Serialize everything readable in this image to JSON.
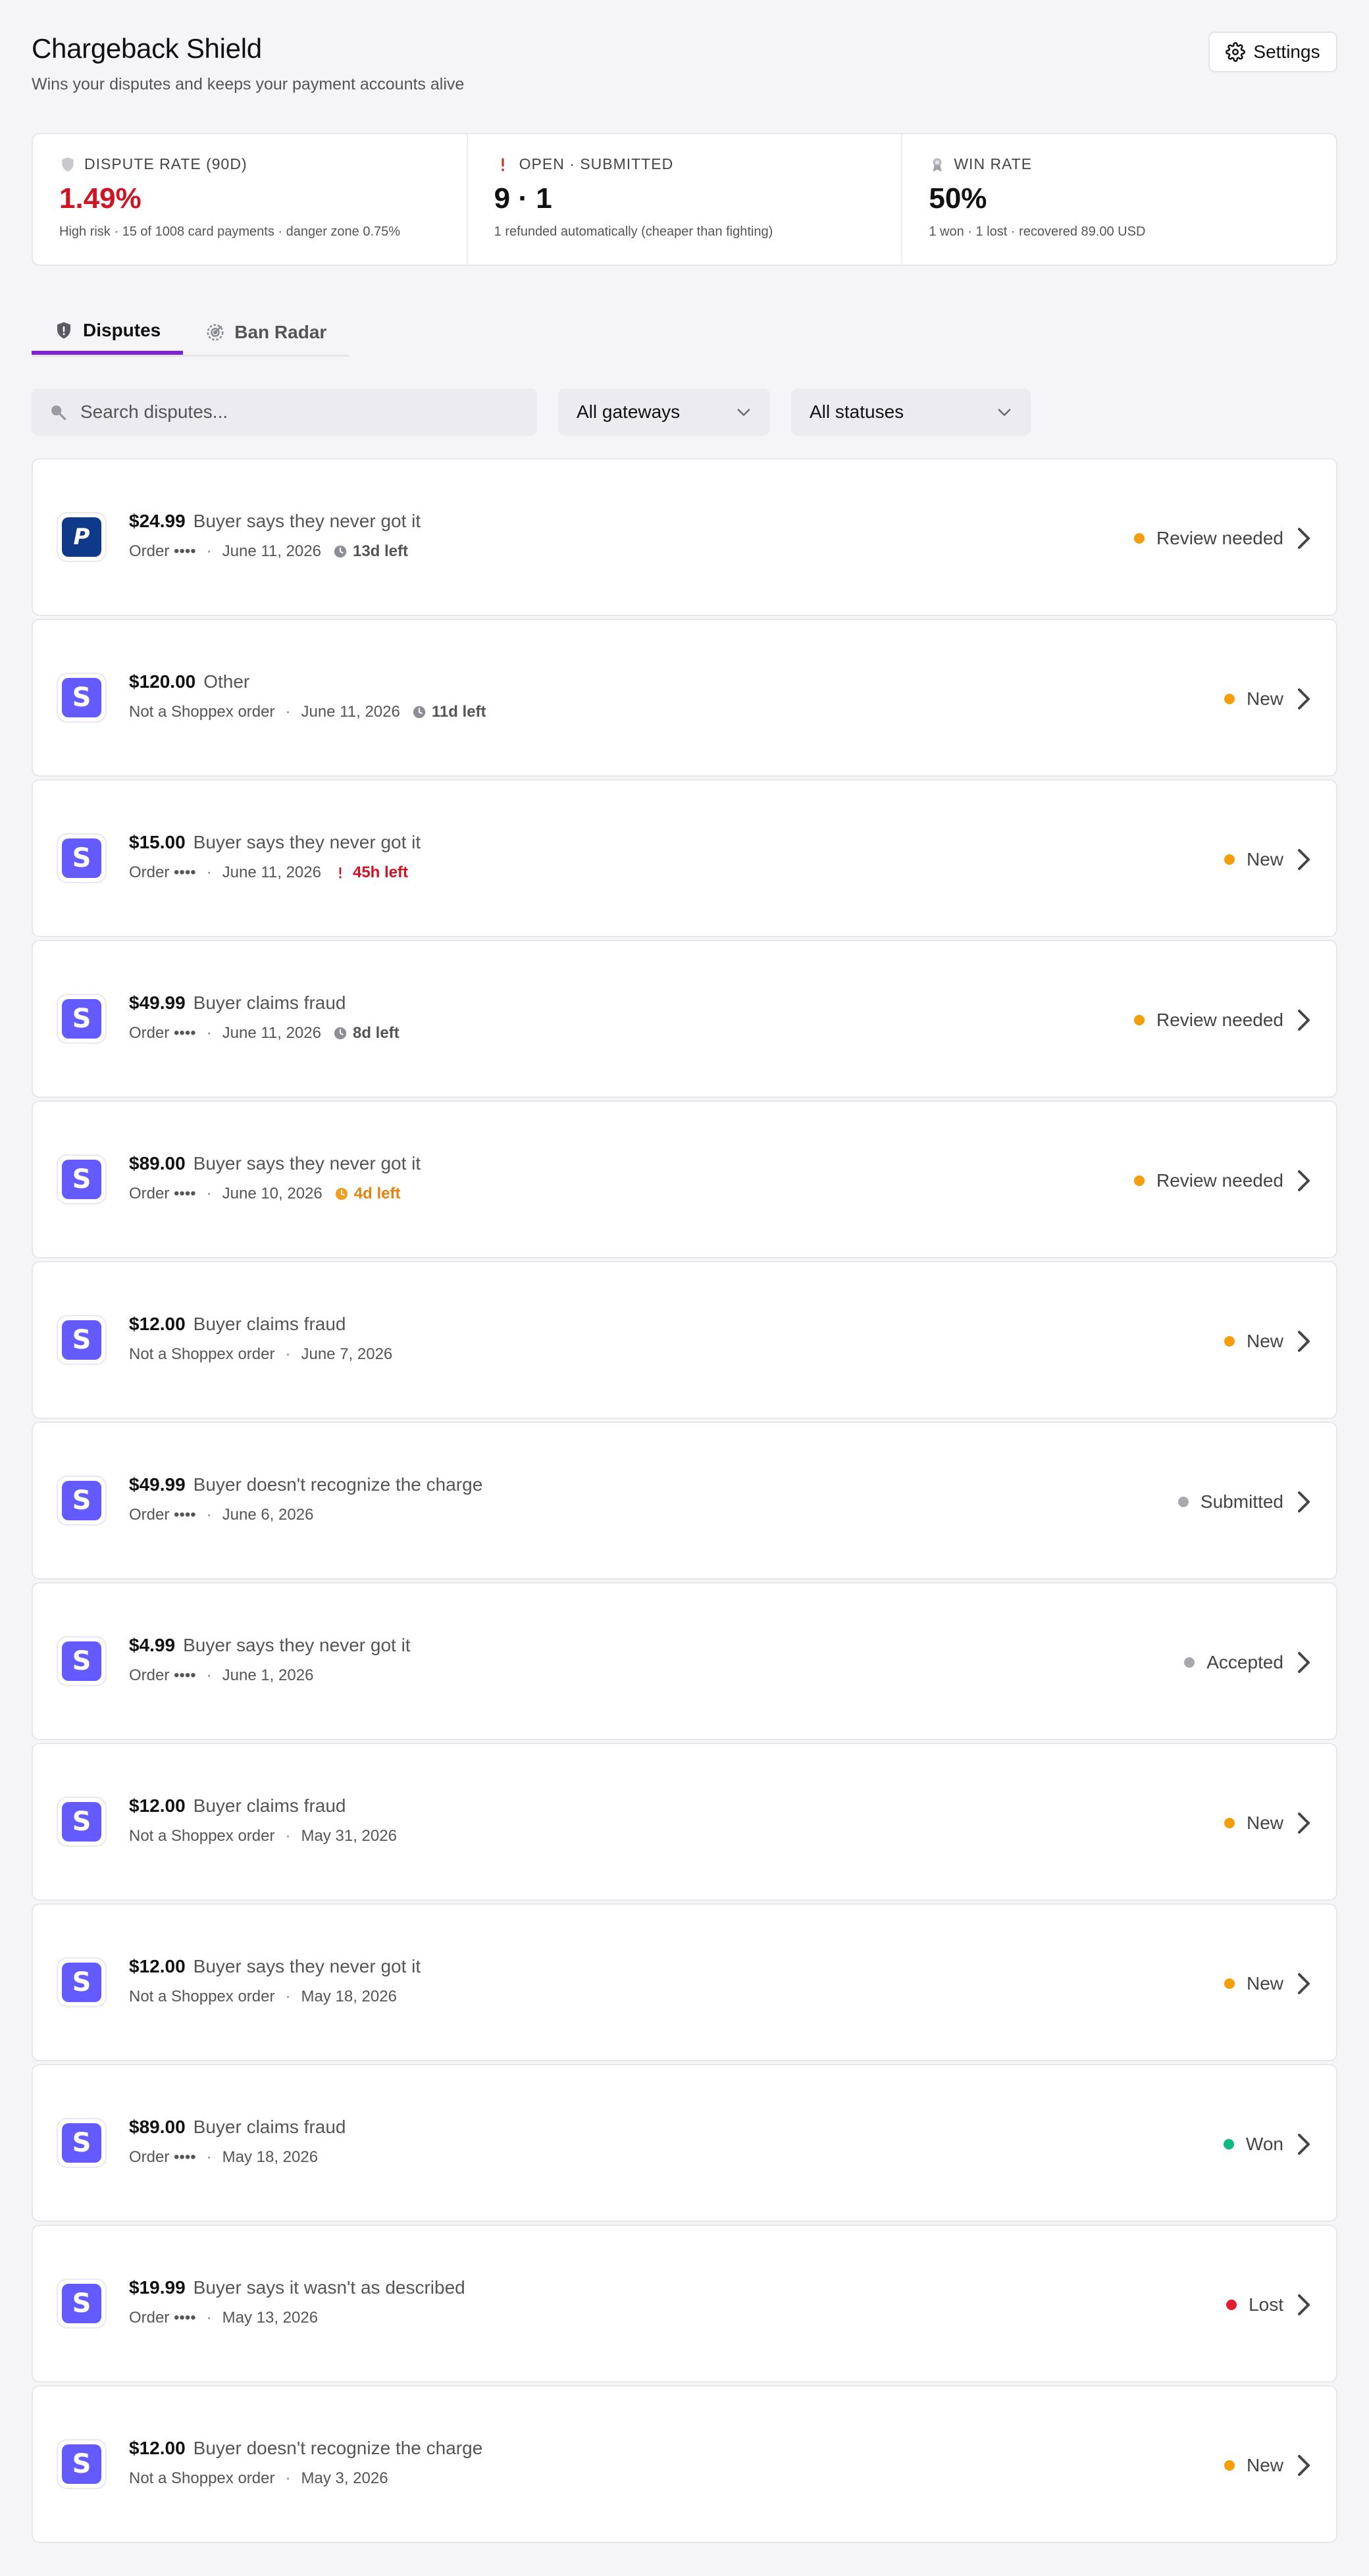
{
  "header": {
    "title": "Chargeback Shield",
    "subtitle": "Wins your disputes and keeps your payment accounts alive",
    "settings_label": "Settings"
  },
  "stats": [
    {
      "icon": "shield-icon",
      "label": "DISPUTE RATE (90D)",
      "value": "1.49%",
      "value_color": "#d01424",
      "note": "High risk · 15 of 1008 card payments · danger zone 0.75%"
    },
    {
      "icon": "exclamation-icon",
      "label": "OPEN · SUBMITTED",
      "value": "9 · 1",
      "note": "1 refunded automatically (cheaper than fighting)"
    },
    {
      "icon": "ribbon-icon",
      "label": "WIN RATE",
      "value": "50%",
      "note": "1 won · 1 lost · recovered 89.00 USD"
    }
  ],
  "tabs": [
    {
      "label": "Disputes",
      "icon": "shield-alert-icon",
      "active": true
    },
    {
      "label": "Ban Radar",
      "icon": "radar-icon",
      "active": false
    }
  ],
  "filters": {
    "search_placeholder": "Search disputes...",
    "gateway_value": "All gateways",
    "status_value": "All statuses"
  },
  "status_colors": {
    "Review needed": "#f59e0b",
    "New": "#f59e0b",
    "Submitted": "#a8a8ae",
    "Accepted": "#a8a8ae",
    "Won": "#10b981",
    "Lost": "#e11d2e"
  },
  "disputes": [
    {
      "gateway": "paypal",
      "amount": "$24.99",
      "reason": "Buyer says they never got it",
      "order": "Order ••••",
      "date": "June 11, 2026",
      "deadline": "13d left",
      "deadline_tone": "gray",
      "status": "Review needed"
    },
    {
      "gateway": "stripe",
      "amount": "$120.00",
      "reason": "Other",
      "order": "Not a Shoppex order",
      "date": "June 11, 2026",
      "deadline": "11d left",
      "deadline_tone": "gray",
      "status": "New"
    },
    {
      "gateway": "stripe",
      "amount": "$15.00",
      "reason": "Buyer says they never got it",
      "order": "Order ••••",
      "date": "June 11, 2026",
      "deadline": "45h left",
      "deadline_tone": "red",
      "status": "New"
    },
    {
      "gateway": "stripe",
      "amount": "$49.99",
      "reason": "Buyer claims fraud",
      "order": "Order ••••",
      "date": "June 11, 2026",
      "deadline": "8d left",
      "deadline_tone": "gray",
      "status": "Review needed"
    },
    {
      "gateway": "stripe",
      "amount": "$89.00",
      "reason": "Buyer says they never got it",
      "order": "Order ••••",
      "date": "June 10, 2026",
      "deadline": "4d left",
      "deadline_tone": "orange",
      "status": "Review needed"
    },
    {
      "gateway": "stripe",
      "amount": "$12.00",
      "reason": "Buyer claims fraud",
      "order": "Not a Shoppex order",
      "date": "June 7, 2026",
      "deadline": "",
      "deadline_tone": "",
      "status": "New"
    },
    {
      "gateway": "stripe",
      "amount": "$49.99",
      "reason": "Buyer doesn't recognize the charge",
      "order": "Order ••••",
      "date": "June 6, 2026",
      "deadline": "",
      "deadline_tone": "",
      "status": "Submitted"
    },
    {
      "gateway": "stripe",
      "amount": "$4.99",
      "reason": "Buyer says they never got it",
      "order": "Order ••••",
      "date": "June 1, 2026",
      "deadline": "",
      "deadline_tone": "",
      "status": "Accepted"
    },
    {
      "gateway": "stripe",
      "amount": "$12.00",
      "reason": "Buyer claims fraud",
      "order": "Not a Shoppex order",
      "date": "May 31, 2026",
      "deadline": "",
      "deadline_tone": "",
      "status": "New"
    },
    {
      "gateway": "stripe",
      "amount": "$12.00",
      "reason": "Buyer says they never got it",
      "order": "Not a Shoppex order",
      "date": "May 18, 2026",
      "deadline": "",
      "deadline_tone": "",
      "status": "New"
    },
    {
      "gateway": "stripe",
      "amount": "$89.00",
      "reason": "Buyer claims fraud",
      "order": "Order ••••",
      "date": "May 18, 2026",
      "deadline": "",
      "deadline_tone": "",
      "status": "Won"
    },
    {
      "gateway": "stripe",
      "amount": "$19.99",
      "reason": "Buyer says it wasn't as described",
      "order": "Order ••••",
      "date": "May 13, 2026",
      "deadline": "",
      "deadline_tone": "",
      "status": "Lost"
    },
    {
      "gateway": "stripe",
      "amount": "$12.00",
      "reason": "Buyer doesn't recognize the charge",
      "order": "Not a Shoppex order",
      "date": "May 3, 2026",
      "deadline": "",
      "deadline_tone": "",
      "status": "New"
    }
  ]
}
